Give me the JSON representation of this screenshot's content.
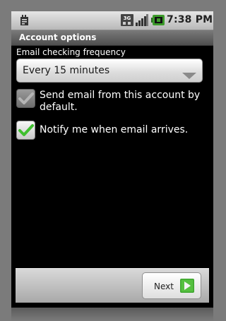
{
  "status_bar": {
    "time": "7:38 PM",
    "network_badge": "3G",
    "icons": [
      "download-notification-icon",
      "3g-icon",
      "signal-icon",
      "battery-icon"
    ]
  },
  "title": "Account options",
  "frequency": {
    "label": "Email checking frequency",
    "selected": "Every 15 minutes"
  },
  "options": [
    {
      "label": "Send email from this account by default.",
      "checked": true,
      "enabled": false
    },
    {
      "label": "Notify me when email arrives.",
      "checked": true,
      "enabled": true
    }
  ],
  "footer": {
    "next_label": "Next"
  },
  "colors": {
    "check_green": "#3fbf2f",
    "battery_green": "#3c9a2a"
  }
}
